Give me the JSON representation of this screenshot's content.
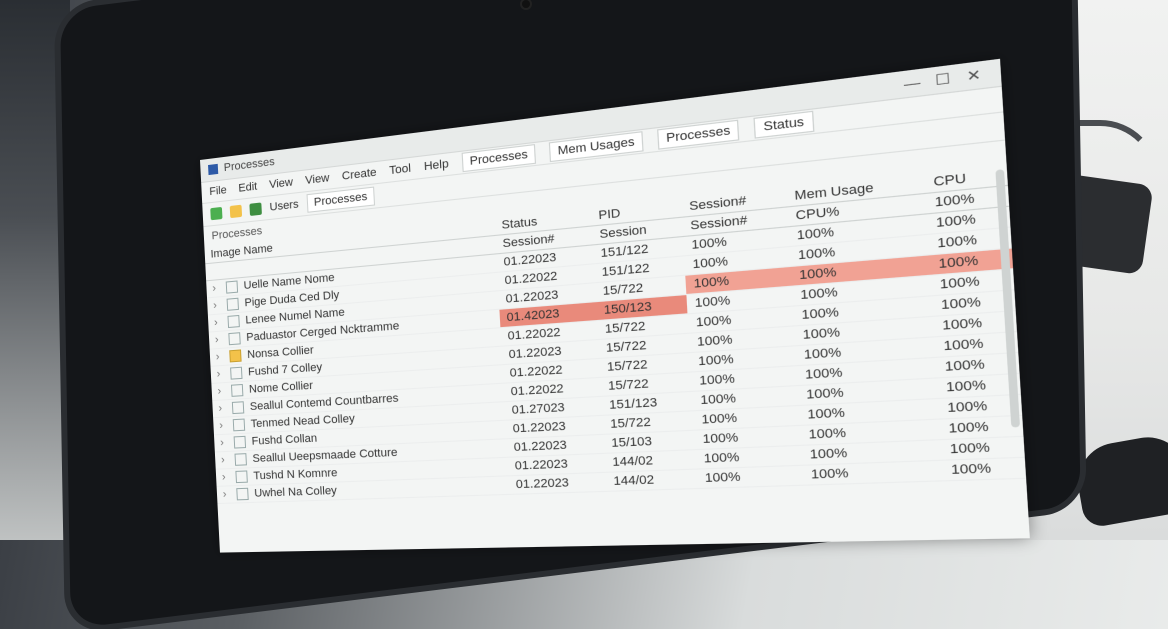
{
  "window": {
    "title": "Processes",
    "controls": {
      "minimize": "—",
      "maximize": "☐",
      "close": "✕"
    }
  },
  "menu": [
    "File",
    "Edit",
    "View",
    "View",
    "Create",
    "Tool",
    "Help"
  ],
  "tabs": [
    "Processes",
    "Mem Usages",
    "Processes",
    "Status"
  ],
  "toolbar": {
    "label": "Users",
    "tab_label": "Processes"
  },
  "section": "Processes",
  "columns": {
    "name": "Image Name",
    "status": "Status",
    "pid": "PID",
    "session": "Session#",
    "mem": "Mem Usage",
    "cpu": "CPU"
  },
  "subheaders": {
    "status": "Session#",
    "pid": "Session",
    "session": "Session#",
    "mem": "CPU%",
    "cpu": "100%"
  },
  "rows": [
    {
      "name": "Uelle Name Nome",
      "status": "01.22023",
      "pid": "151/122",
      "session": "100%",
      "mem": "100%",
      "cpu": "100%"
    },
    {
      "name": "Pige Duda Ced Dly",
      "status": "01.22022",
      "pid": "151/122",
      "session": "100%",
      "mem": "100%",
      "cpu": "100%"
    },
    {
      "name": "Lenee Numel Name",
      "status": "01.22023",
      "pid": "15/722",
      "session": "100%",
      "mem": "100%",
      "cpu": "100%",
      "highlight": "mem"
    },
    {
      "name": "Paduastor Cerged Ncktramme",
      "status": "01.42023",
      "pid": "150/123",
      "session": "100%",
      "mem": "100%",
      "cpu": "100%",
      "highlight": "status"
    },
    {
      "name": "Nonsa Collier",
      "status": "01.22022",
      "pid": "15/722",
      "session": "100%",
      "mem": "100%",
      "cpu": "100%",
      "folder": true
    },
    {
      "name": "Fushd 7 Colley",
      "status": "01.22023",
      "pid": "15/722",
      "session": "100%",
      "mem": "100%",
      "cpu": "100%"
    },
    {
      "name": "Nome Collier",
      "status": "01.22022",
      "pid": "15/722",
      "session": "100%",
      "mem": "100%",
      "cpu": "100%"
    },
    {
      "name": "Seallul Contemd Countbarres",
      "status": "01.22022",
      "pid": "15/722",
      "session": "100%",
      "mem": "100%",
      "cpu": "100%"
    },
    {
      "name": "Tenmed Nead Colley",
      "status": "01.27023",
      "pid": "151/123",
      "session": "100%",
      "mem": "100%",
      "cpu": "100%"
    },
    {
      "name": "Fushd Collan",
      "status": "01.22023",
      "pid": "15/722",
      "session": "100%",
      "mem": "100%",
      "cpu": "100%"
    },
    {
      "name": "Seallul Ueepsmaade Cotture",
      "status": "01.22023",
      "pid": "15/103",
      "session": "100%",
      "mem": "100%",
      "cpu": "100%"
    },
    {
      "name": "Tushd N Komnre",
      "status": "01.22023",
      "pid": "144/02",
      "session": "100%",
      "mem": "100%",
      "cpu": "100%"
    },
    {
      "name": "Uwhel Na Colley",
      "status": "01.22023",
      "pid": "144/02",
      "session": "100%",
      "mem": "100%",
      "cpu": "100%"
    }
  ],
  "colors": {
    "highlight": "#e98a7b",
    "accent": "#2d5aa7"
  }
}
